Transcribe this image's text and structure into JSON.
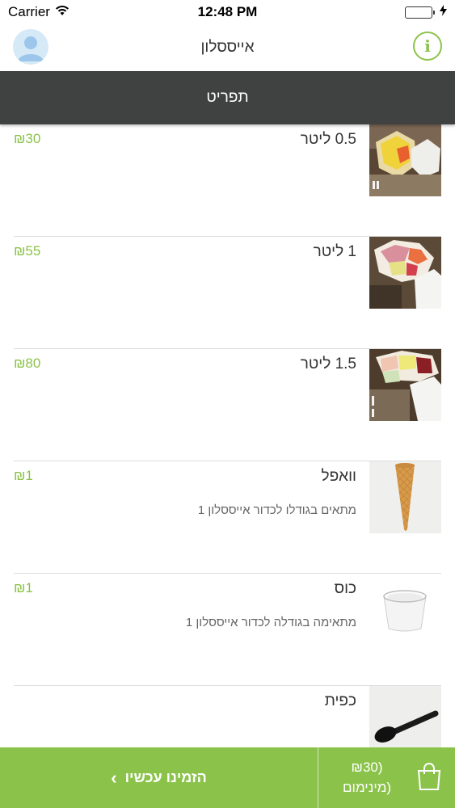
{
  "status_bar": {
    "carrier": "Carrier",
    "time": "12:48 PM"
  },
  "header": {
    "title": "אייססלון"
  },
  "menu_bar": {
    "label": "תפריט"
  },
  "items": [
    {
      "name": "0.5 ליטר",
      "description": "",
      "price": "₪30"
    },
    {
      "name": "1 ליטר",
      "description": "",
      "price": "₪55"
    },
    {
      "name": "1.5 ליטר",
      "description": "",
      "price": "₪80"
    },
    {
      "name": "וואפל",
      "description": "מתאים בגודלו לכדור אייססלון 1",
      "price": "₪1"
    },
    {
      "name": "כוס",
      "description": "מתאימה בגודלה לכדור אייססלון 1",
      "price": "₪1"
    },
    {
      "name": "כפית",
      "description": "",
      "price": ""
    }
  ],
  "bottom_bar": {
    "order_label": "הזמינו עכשיו",
    "cart_line1": "₪30)",
    "cart_line2": "מינימום)"
  },
  "colors": {
    "accent": "#8bc34a",
    "menu_bar": "#3f4240"
  },
  "icons": [
    "wifi-icon",
    "battery-icon",
    "charging-icon",
    "avatar-icon",
    "info-icon",
    "chevron-left-icon",
    "shopping-bag-icon"
  ]
}
